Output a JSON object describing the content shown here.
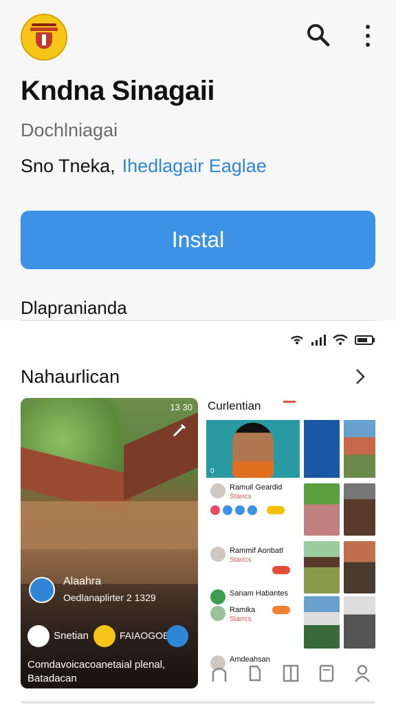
{
  "header": {
    "title": "Kndna Sinagaii",
    "developer": "Dochlniagai",
    "meta_prefix": "Sno Tneka,",
    "meta_link": "Ihedlagair Eaglae",
    "install_label": "Instal",
    "section_label": "Dlapranianda"
  },
  "panel": {
    "section_title": "Nahaurlican",
    "feature_card": {
      "time": "13 30",
      "name": "Alaahra",
      "subtitle": "Oedlanaplirter",
      "subtitle_num": "2 1329",
      "chip1_label": "Snetian",
      "chip2_label": "FAIAOGOE",
      "caption": "Comdavoicacoanetaial plenal, Batadacan"
    },
    "feed": {
      "title": "Curlentian",
      "main_badge": "0",
      "posts": [
        {
          "name": "Ramuil Geardid",
          "sub": "Starrcs"
        },
        {
          "name": "Rammif Aonbatl",
          "sub": "Starrcs"
        },
        {
          "name": "Sanam Habantes",
          "sub": ""
        },
        {
          "name": "Ramika",
          "sub": "Starrcs"
        },
        {
          "name": "Amdeahsan",
          "sub": ""
        }
      ]
    }
  },
  "colors": {
    "accent": "#3b92e6",
    "link": "#2f86d6"
  }
}
